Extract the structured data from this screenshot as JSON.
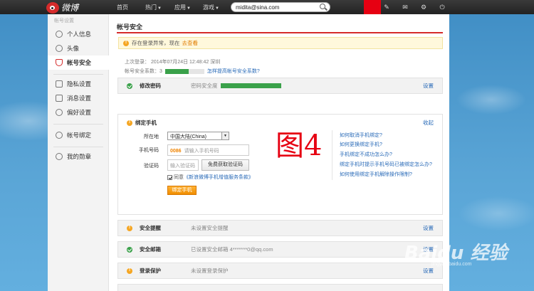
{
  "topbar": {
    "logo_text": "微博",
    "nav": [
      "首页",
      "热门",
      "应用",
      "游戏"
    ],
    "search_value": "midita@sina.com"
  },
  "sidebar": {
    "header": "帐号设置",
    "items": [
      "个人信息",
      "头像",
      "帐号安全",
      "隐私设置",
      "消息设置",
      "偏好设置",
      "帐号绑定",
      "我的勋章"
    ]
  },
  "main": {
    "title": "帐号安全",
    "notice_text": "存在登录异常，现在",
    "notice_link": "去查看",
    "last_login": "上次登录：  2014年07月24日   12:48:42   深圳",
    "score_label": "帐号安全系数：3",
    "score_fraction": 0.6,
    "score_link": "怎样提高帐号安全系数?",
    "fig_label": "图4"
  },
  "rows": [
    {
      "label": "修改密码",
      "status": "密码安全度",
      "action": "设置",
      "state": "ok"
    },
    {
      "label": "安全提醒",
      "status": "未设置安全提醒",
      "action": "设置",
      "state": "warn"
    },
    {
      "label": "安全邮箱",
      "status": "已设置安全邮箱 4*******0@qq.com",
      "action": "设置",
      "state": "ok"
    },
    {
      "label": "登录保护",
      "status": "未设置登录保护",
      "action": "设置",
      "state": "warn"
    }
  ],
  "phone": {
    "title": "绑定手机",
    "collapse": "收起",
    "region_label": "所在地",
    "region_value": "中国大陆(China)",
    "phone_label": "手机号码",
    "phone_prefix": "0086",
    "phone_placeholder": "请输入手机号码",
    "code_label": "验证码",
    "code_placeholder": "输入验证码",
    "code_button": "免费获取验证码",
    "agree_text": "同意",
    "agree_link": "《新浪微博手机增值服务条款》",
    "bind_button": "绑定手机",
    "faq": [
      "如何取消手机绑定?",
      "如何更换绑定手机?",
      "手机绑定不成功怎么办?",
      "绑定手机时提示手机号码已被绑定怎么办?",
      "如何使用绑定手机解除操作限制?"
    ]
  },
  "watermark": {
    "main": "Baidu 经验",
    "sub": "jingyan.baidu.com"
  },
  "colors": {
    "accent": "#d52b2b",
    "link": "#2a6bb8",
    "ok": "#3aa14a",
    "warn": "#f5a623",
    "button": "#f08d00"
  }
}
